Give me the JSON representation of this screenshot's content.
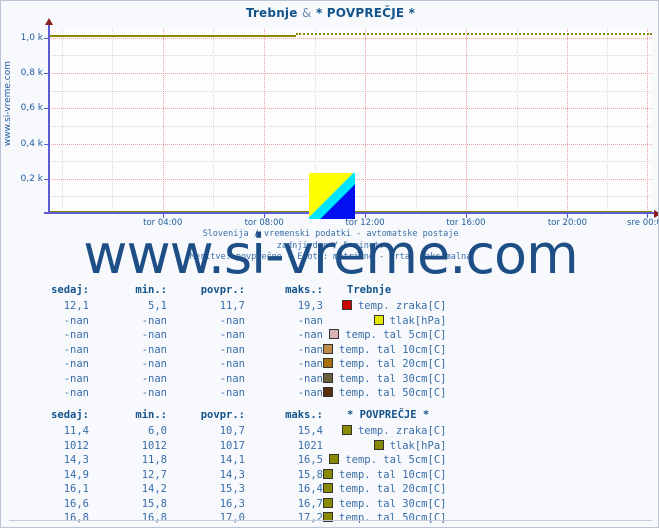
{
  "chart_title_main": "Trebnje",
  "chart_title_sep": "&",
  "chart_title_second": "* POVPREČJE *",
  "side_watermark": "www.si-vreme.com",
  "big_watermark": "www.si-vreme.com",
  "subtitle": {
    "line1": "Slovenija / vremenski podatki - avtomatske postaje",
    "line2": "zadnji dan / 5 minut.",
    "line3": "Meritve: povprečne - Enote: metrične - Črta: maksimalna"
  },
  "logo": {
    "name": "si-vreme-logo",
    "colors": [
      "#ffff00",
      "#00e8ff",
      "#0010ee"
    ]
  },
  "chart_data": {
    "type": "line",
    "title": "Trebnje & * POVPREČJE *",
    "xlabel": "",
    "ylabel": "",
    "ylim": [
      0,
      1050
    ],
    "yticks": [
      200,
      400,
      600,
      800,
      1000
    ],
    "ytick_labels": [
      "0,2 k",
      "0,4 k",
      "0,6 k",
      "0,8 k",
      "1,0 k"
    ],
    "x": [
      "tor 04:00",
      "tor 08:00",
      "tor 12:00",
      "tor 16:00",
      "tor 20:00",
      "sre 00:00"
    ],
    "xtick_positions_pct": [
      19.0,
      35.8,
      52.5,
      69.2,
      86.0,
      99.2
    ],
    "grid": true,
    "legend_position": "below-table",
    "series": [
      {
        "name": "Trebnje temp. zraka[C]",
        "color": "#cc0000",
        "value": 12.1,
        "y_pct": 98.8,
        "style": "solid",
        "from_pct": 0,
        "to_pct": 100
      },
      {
        "name": "Trebnje tlak[hPa]",
        "color": "#e6e600",
        "value": null,
        "style": "none"
      },
      {
        "name": "* POVPREČJE * tlak[hPa]",
        "color": "#8a8a00",
        "value": 1012,
        "y_pct": 3.5,
        "style": "solid",
        "from_pct": 0,
        "to_pct": 41
      },
      {
        "name": "* POVPREČJE * tlak[hPa] (max)",
        "color": "#8a8a00",
        "value": 1021,
        "y_pct": 2.4,
        "style": "dotted",
        "from_pct": 41,
        "to_pct": 100
      },
      {
        "name": "* POVPREČJE * temp. tal 50cm[C]",
        "color": "#8a8a00",
        "value": 16.8,
        "y_pct": 98.4,
        "style": "solid",
        "from_pct": 0,
        "to_pct": 100
      }
    ]
  },
  "tables": [
    {
      "id": "station-table",
      "headers": {
        "sedaj": "sedaj:",
        "min": "min.:",
        "povpr": "povpr.:",
        "maks": "maks.:",
        "name": "Trebnje"
      },
      "rows": [
        {
          "sedaj": "12,1",
          "min": "5,1",
          "povpr": "11,7",
          "maks": "19,3",
          "color": "#cc0000",
          "label": "temp. zraka[C]"
        },
        {
          "sedaj": "-nan",
          "min": "-nan",
          "povpr": "-nan",
          "maks": "-nan",
          "color": "#e6e600",
          "label": "tlak[hPa]"
        },
        {
          "sedaj": "-nan",
          "min": "-nan",
          "povpr": "-nan",
          "maks": "-nan",
          "color": "#d9b3b3",
          "label": "temp. tal  5cm[C]"
        },
        {
          "sedaj": "-nan",
          "min": "-nan",
          "povpr": "-nan",
          "maks": "-nan",
          "color": "#c08a4a",
          "label": "temp. tal 10cm[C]"
        },
        {
          "sedaj": "-nan",
          "min": "-nan",
          "povpr": "-nan",
          "maks": "-nan",
          "color": "#a8700c",
          "label": "temp. tal 20cm[C]"
        },
        {
          "sedaj": "-nan",
          "min": "-nan",
          "povpr": "-nan",
          "maks": "-nan",
          "color": "#6b5f3c",
          "label": "temp. tal 30cm[C]"
        },
        {
          "sedaj": "-nan",
          "min": "-nan",
          "povpr": "-nan",
          "maks": "-nan",
          "color": "#5c2f0c",
          "label": "temp. tal 50cm[C]"
        }
      ]
    },
    {
      "id": "average-table",
      "headers": {
        "sedaj": "sedaj:",
        "min": "min.:",
        "povpr": "povpr.:",
        "maks": "maks.:",
        "name": "* POVPREČJE *"
      },
      "rows": [
        {
          "sedaj": "11,4",
          "min": "6,0",
          "povpr": "10,7",
          "maks": "15,4",
          "color": "#8a8a00",
          "label": "temp. zraka[C]"
        },
        {
          "sedaj": "1012",
          "min": "1012",
          "povpr": "1017",
          "maks": "1021",
          "color": "#8a8a00",
          "label": "tlak[hPa]"
        },
        {
          "sedaj": "14,3",
          "min": "11,8",
          "povpr": "14,1",
          "maks": "16,5",
          "color": "#8a8a00",
          "label": "temp. tal  5cm[C]"
        },
        {
          "sedaj": "14,9",
          "min": "12,7",
          "povpr": "14,3",
          "maks": "15,8",
          "color": "#8a8a00",
          "label": "temp. tal 10cm[C]"
        },
        {
          "sedaj": "16,1",
          "min": "14,2",
          "povpr": "15,3",
          "maks": "16,4",
          "color": "#8a8a00",
          "label": "temp. tal 20cm[C]"
        },
        {
          "sedaj": "16,6",
          "min": "15,8",
          "povpr": "16,3",
          "maks": "16,7",
          "color": "#8a8a00",
          "label": "temp. tal 30cm[C]"
        },
        {
          "sedaj": "16,8",
          "min": "16,8",
          "povpr": "17,0",
          "maks": "17,2",
          "color": "#8a8a00",
          "label": "temp. tal 50cm[C]"
        }
      ]
    }
  ]
}
